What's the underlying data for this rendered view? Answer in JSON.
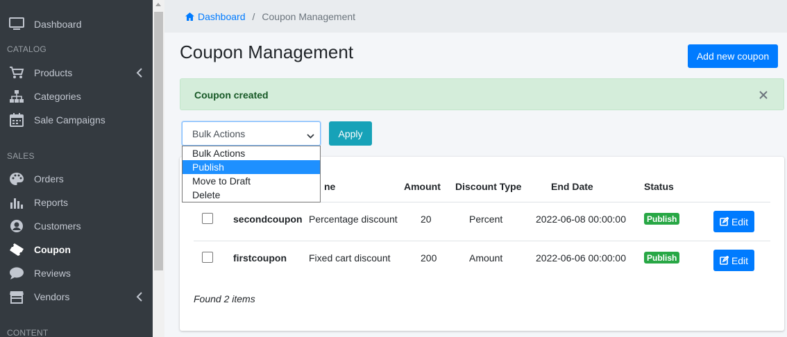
{
  "sidebar": {
    "items": [
      {
        "label": "Dashboard",
        "icon": "monitor-icon"
      },
      {
        "label": "Products",
        "icon": "cart-icon"
      },
      {
        "label": "Categories",
        "icon": "sitemap-icon"
      },
      {
        "label": "Sale Campaigns",
        "icon": "calendar-icon"
      },
      {
        "label": "Orders",
        "icon": "palette-icon"
      },
      {
        "label": "Reports",
        "icon": "bar-chart-icon"
      },
      {
        "label": "Customers",
        "icon": "user-circle-icon"
      },
      {
        "label": "Coupon",
        "icon": "ticket-icon"
      },
      {
        "label": "Reviews",
        "icon": "comment-icon"
      },
      {
        "label": "Vendors",
        "icon": "store-icon"
      }
    ],
    "headers": {
      "catalog": "CATALOG",
      "sales": "SALES",
      "content": "CONTENT"
    }
  },
  "breadcrumb": {
    "home": "Dashboard",
    "separator": "/",
    "current": "Coupon Management"
  },
  "page": {
    "title": "Coupon Management",
    "add_button": "Add new coupon"
  },
  "alert": {
    "text": "Coupon created",
    "close": "×"
  },
  "bulk": {
    "selected": "Bulk Actions",
    "apply": "Apply",
    "options": [
      "Bulk Actions",
      "Publish",
      "Move to Draft",
      "Delete"
    ],
    "highlighted": "Publish"
  },
  "table": {
    "columns": [
      "ne",
      "Amount",
      "Discount Type",
      "End Date",
      "Status"
    ],
    "rows": [
      {
        "code": "secondcoupon",
        "name": "Percentage discount",
        "amount": "20",
        "discount_type": "Percent",
        "end_date": "2022-06-08 00:00:00",
        "status": "Publish",
        "edit": "Edit"
      },
      {
        "code": "firstcoupon",
        "name": "Fixed cart discount",
        "amount": "200",
        "discount_type": "Amount",
        "end_date": "2022-06-06 00:00:00",
        "status": "Publish",
        "edit": "Edit"
      }
    ],
    "footer": "Found 2 items"
  },
  "colors": {
    "sidebar_bg": "#343a40",
    "primary": "#007bff",
    "info": "#17a2b8",
    "success": "#28a745",
    "alert_bg": "#d4edda"
  }
}
